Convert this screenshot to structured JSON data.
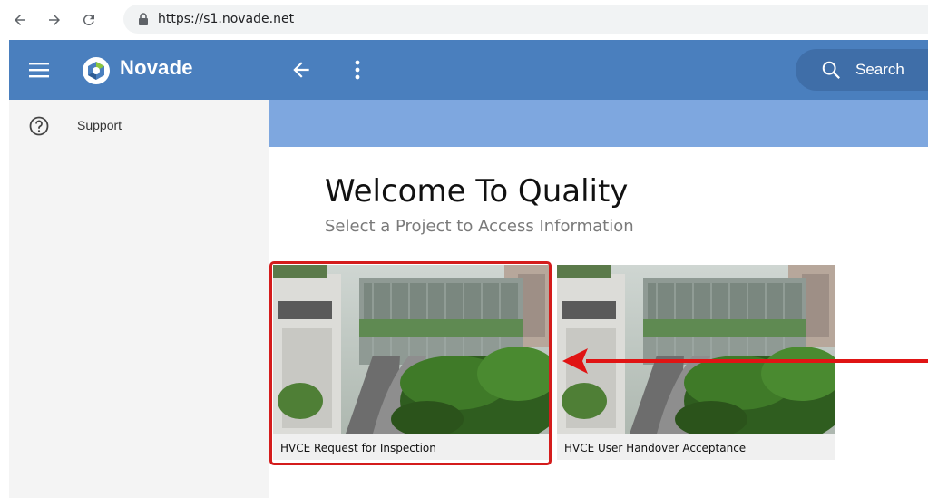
{
  "browser": {
    "url": "https://s1.novade.net"
  },
  "app": {
    "brand": "Novade",
    "search_label": "Search"
  },
  "sidebar": {
    "items": [
      {
        "label": "Support",
        "icon": "help-circle-icon"
      }
    ]
  },
  "main": {
    "title": "Welcome To Quality",
    "subtitle": "Select a Project to Access Information",
    "projects": [
      {
        "label": "HVCE Request for Inspection",
        "selected": true
      },
      {
        "label": "HVCE User Handover Acceptance",
        "selected": false
      }
    ]
  },
  "colors": {
    "appbar": "#4a7fbe",
    "banner": "#7ea7df",
    "highlight": "#d41c1c"
  }
}
